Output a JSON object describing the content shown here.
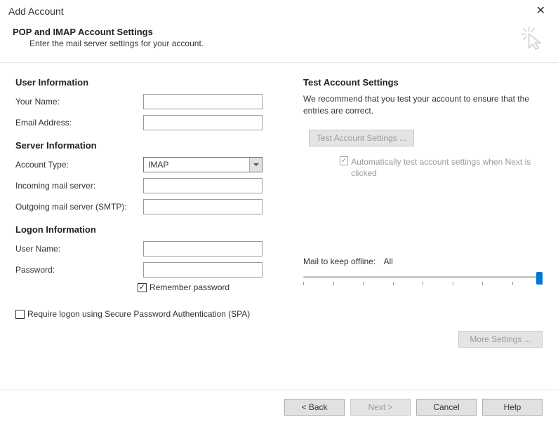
{
  "window": {
    "title": "Add Account"
  },
  "header": {
    "heading": "POP and IMAP Account Settings",
    "subheading": "Enter the mail server settings for your account."
  },
  "left": {
    "user_info_title": "User Information",
    "your_name_label": "Your Name:",
    "your_name_value": "",
    "email_label": "Email Address:",
    "email_value": "",
    "server_info_title": "Server Information",
    "account_type_label": "Account Type:",
    "account_type_value": "IMAP",
    "incoming_label": "Incoming mail server:",
    "incoming_value": "",
    "outgoing_label": "Outgoing mail server (SMTP):",
    "outgoing_value": "",
    "logon_info_title": "Logon Information",
    "username_label": "User Name:",
    "username_value": "",
    "password_label": "Password:",
    "password_value": "",
    "remember_pw_label": "Remember password",
    "spa_label": "Require logon using Secure Password Authentication (SPA)"
  },
  "right": {
    "test_title": "Test Account Settings",
    "test_desc": "We recommend that you test your account to ensure that the entries are correct.",
    "test_btn": "Test Account Settings ...",
    "auto_test_label": "Automatically test account settings when Next is clicked",
    "mail_offline_label": "Mail to keep offline:",
    "mail_offline_value": "All",
    "more_settings_btn": "More Settings ..."
  },
  "footer": {
    "back": "< Back",
    "next": "Next >",
    "cancel": "Cancel",
    "help": "Help"
  }
}
